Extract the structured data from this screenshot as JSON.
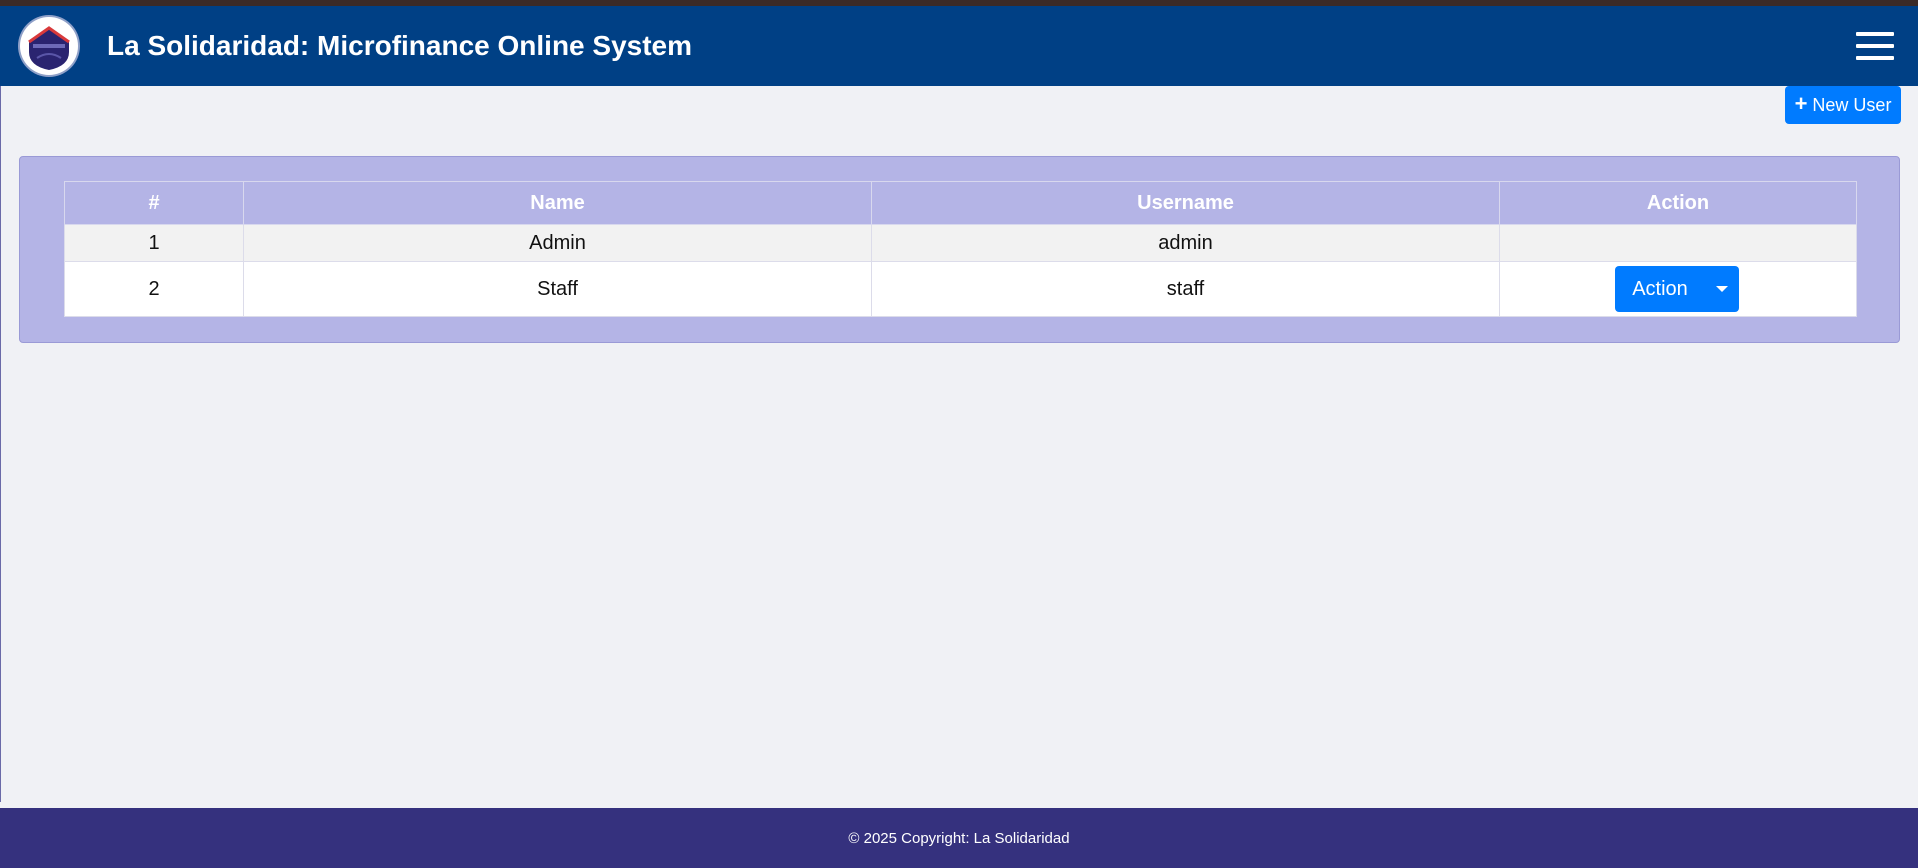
{
  "header": {
    "title": "La Solidaridad: Microfinance Online System",
    "logo_text": "LA SOLIDARIDAD",
    "menu_icon": "hamburger-menu-icon"
  },
  "toolbar": {
    "new_user_label": "New User",
    "new_user_icon": "plus-icon"
  },
  "users_table": {
    "columns": [
      "#",
      "Name",
      "Username",
      "Action"
    ],
    "rows": [
      {
        "num": "1",
        "name": "Admin",
        "username": "admin",
        "action": ""
      },
      {
        "num": "2",
        "name": "Staff",
        "username": "staff",
        "action": "Action"
      }
    ]
  },
  "footer": {
    "text": "© 2025 Copyright: La Solidaridad"
  },
  "colors": {
    "navbar": "#004085",
    "primary": "#007bff",
    "card": "#b4b4e6",
    "footer": "#35317e",
    "background": "#f0f1f5"
  }
}
